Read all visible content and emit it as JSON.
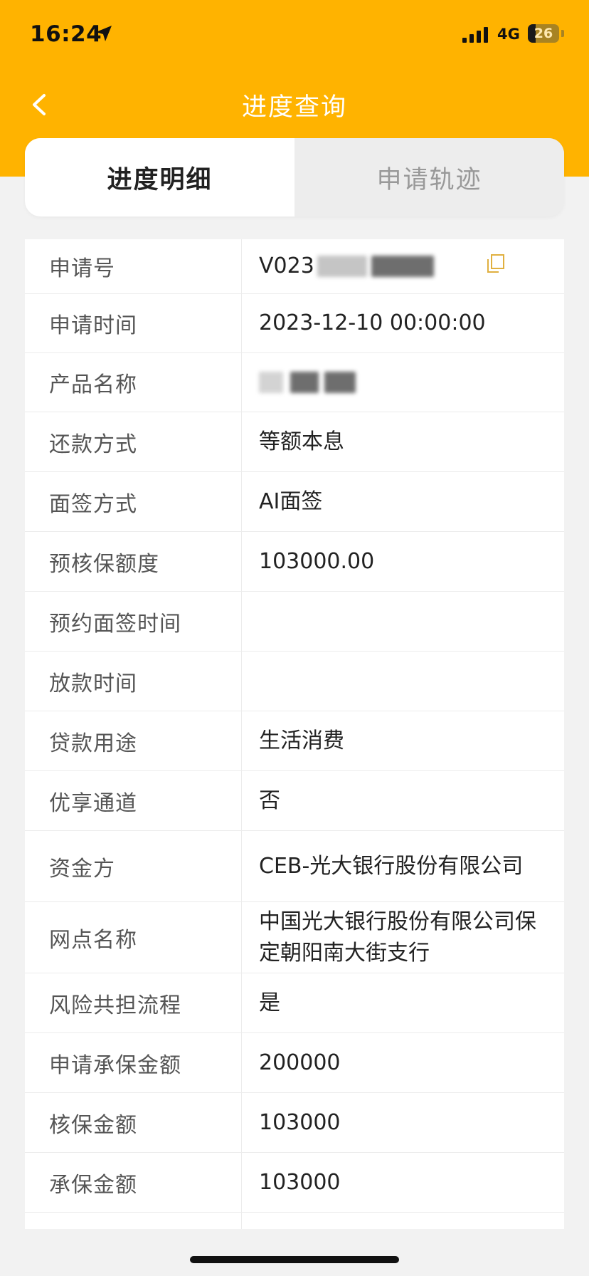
{
  "status_bar": {
    "time": "16:24",
    "network": "4G",
    "battery": "26",
    "battery_level": 0.26
  },
  "nav": {
    "back_icon": "chevron-left-icon",
    "title": "进度查询"
  },
  "tabs": [
    {
      "label": "进度明细",
      "active": true
    },
    {
      "label": "申请轨迹",
      "active": false
    }
  ],
  "details": [
    {
      "label": "申请号",
      "value": "V023"
    },
    {
      "label": "申请时间",
      "value": "2023-12-10 00:00:00"
    },
    {
      "label": "产品名称",
      "value": ""
    },
    {
      "label": "还款方式",
      "value": "等额本息"
    },
    {
      "label": "面签方式",
      "value": "AI面签"
    },
    {
      "label": "预核保额度",
      "value": "103000.00"
    },
    {
      "label": "预约面签时间",
      "value": ""
    },
    {
      "label": "放款时间",
      "value": ""
    },
    {
      "label": "贷款用途",
      "value": "生活消费"
    },
    {
      "label": "优享通道",
      "value": "否"
    },
    {
      "label": "资金方",
      "value": "CEB-光大银行股份有限公司"
    },
    {
      "label": "网点名称",
      "value": "中国光大银行股份有限公司保定朝阳南大街支行"
    },
    {
      "label": "风险共担流程",
      "value": "是"
    },
    {
      "label": "申请承保金额",
      "value": "200000"
    },
    {
      "label": "核保金额",
      "value": "103000"
    },
    {
      "label": "承保金额",
      "value": "103000"
    },
    {
      "label": "",
      "value": ""
    }
  ],
  "colors": {
    "brand": "#FFB300",
    "copy_icon": "#E0B040"
  }
}
